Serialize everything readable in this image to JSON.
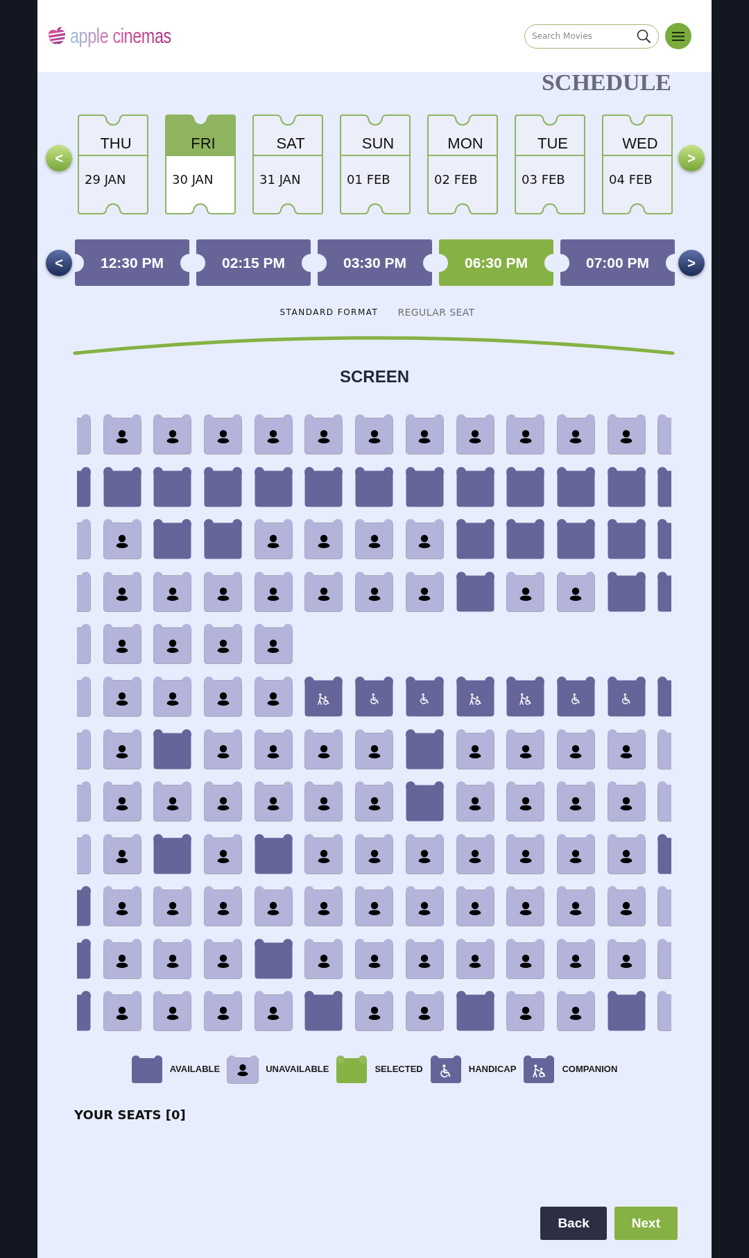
{
  "header": {
    "logo_text": "apple cinemas",
    "search": {
      "placeholder": "Search Movies"
    }
  },
  "schedule": {
    "title": "SCHEDULE",
    "date_nav": {
      "prev": "<",
      "next": ">"
    },
    "dates": [
      {
        "day": "THU",
        "date": "29 JAN",
        "selected": false
      },
      {
        "day": "FRI",
        "date": "30 JAN",
        "selected": true
      },
      {
        "day": "SAT",
        "date": "31 JAN",
        "selected": false
      },
      {
        "day": "SUN",
        "date": "01 FEB",
        "selected": false
      },
      {
        "day": "MON",
        "date": "02 FEB",
        "selected": false
      },
      {
        "day": "TUE",
        "date": "03 FEB",
        "selected": false
      },
      {
        "day": "WED",
        "date": "04 FEB",
        "selected": false
      }
    ],
    "time_nav": {
      "prev": "<",
      "next": ">"
    },
    "times": [
      {
        "label": "12:30 PM",
        "selected": false
      },
      {
        "label": "02:15 PM",
        "selected": false
      },
      {
        "label": "03:30 PM",
        "selected": false
      },
      {
        "label": "06:30 PM",
        "selected": true
      },
      {
        "label": "07:00 PM",
        "selected": false
      }
    ],
    "format": "STANDARD FORMAT",
    "seat_type": "REGULAR SEAT"
  },
  "screen_label": "SCREEN",
  "seat_sections": [
    {
      "rows": [
        {
          "seats": [
            {
              "kind": "unavailable"
            },
            {
              "kind": "unavailable"
            },
            {
              "kind": "unavailable"
            },
            {
              "kind": "unavailable"
            },
            {
              "kind": "unavailable"
            },
            {
              "kind": "unavailable"
            },
            {
              "kind": "unavailable"
            },
            {
              "kind": "unavailable"
            },
            {
              "kind": "unavailable"
            },
            {
              "kind": "unavailable"
            },
            {
              "kind": "unavailable"
            },
            {
              "kind": "unavailable"
            },
            {
              "kind": "unavailable"
            }
          ]
        },
        {
          "seats": [
            {
              "kind": "available"
            },
            {
              "kind": "available"
            },
            {
              "kind": "available"
            },
            {
              "kind": "available"
            },
            {
              "kind": "available"
            },
            {
              "kind": "available"
            },
            {
              "kind": "available"
            },
            {
              "kind": "available"
            },
            {
              "kind": "available"
            },
            {
              "kind": "available"
            },
            {
              "kind": "available"
            },
            {
              "kind": "available"
            },
            {
              "kind": "available"
            }
          ]
        },
        {
          "seats": [
            {
              "kind": "unavailable"
            },
            {
              "kind": "unavailable"
            },
            {
              "kind": "available"
            },
            {
              "kind": "available"
            },
            {
              "kind": "unavailable"
            },
            {
              "kind": "unavailable"
            },
            {
              "kind": "unavailable"
            },
            {
              "kind": "unavailable"
            },
            {
              "kind": "available"
            },
            {
              "kind": "available"
            },
            {
              "kind": "available"
            },
            {
              "kind": "available"
            },
            {
              "kind": "available"
            }
          ]
        },
        {
          "seats": [
            {
              "kind": "unavailable"
            },
            {
              "kind": "unavailable"
            },
            {
              "kind": "unavailable"
            },
            {
              "kind": "unavailable"
            },
            {
              "kind": "unavailable"
            },
            {
              "kind": "unavailable"
            },
            {
              "kind": "unavailable"
            },
            {
              "kind": "unavailable"
            },
            {
              "kind": "available"
            },
            {
              "kind": "unavailable"
            },
            {
              "kind": "unavailable"
            },
            {
              "kind": "available"
            },
            {
              "kind": "available"
            }
          ]
        },
        {
          "seats": [
            {
              "kind": "unavailable"
            },
            {
              "kind": "unavailable"
            },
            {
              "kind": "unavailable"
            },
            {
              "kind": "unavailable"
            },
            {
              "kind": "unavailable"
            }
          ]
        }
      ]
    },
    {
      "rows": [
        {
          "seats": [
            {
              "kind": "unavailable"
            },
            {
              "kind": "unavailable"
            },
            {
              "kind": "unavailable"
            },
            {
              "kind": "unavailable"
            },
            {
              "kind": "unavailable"
            },
            {
              "kind": "companion"
            },
            {
              "kind": "handicap"
            },
            {
              "kind": "handicap"
            },
            {
              "kind": "companion"
            },
            {
              "kind": "companion"
            },
            {
              "kind": "handicap"
            },
            {
              "kind": "handicap"
            },
            {
              "kind": "available"
            }
          ]
        },
        {
          "seats": [
            {
              "kind": "unavailable"
            },
            {
              "kind": "unavailable"
            },
            {
              "kind": "available"
            },
            {
              "kind": "unavailable"
            },
            {
              "kind": "unavailable"
            },
            {
              "kind": "unavailable"
            },
            {
              "kind": "unavailable"
            },
            {
              "kind": "available"
            },
            {
              "kind": "unavailable"
            },
            {
              "kind": "unavailable"
            },
            {
              "kind": "unavailable"
            },
            {
              "kind": "unavailable"
            },
            {
              "kind": "unavailable"
            }
          ]
        },
        {
          "seats": [
            {
              "kind": "unavailable"
            },
            {
              "kind": "unavailable"
            },
            {
              "kind": "unavailable"
            },
            {
              "kind": "unavailable"
            },
            {
              "kind": "unavailable"
            },
            {
              "kind": "unavailable"
            },
            {
              "kind": "unavailable"
            },
            {
              "kind": "available"
            },
            {
              "kind": "unavailable"
            },
            {
              "kind": "unavailable"
            },
            {
              "kind": "unavailable"
            },
            {
              "kind": "unavailable"
            },
            {
              "kind": "unavailable"
            }
          ]
        },
        {
          "seats": [
            {
              "kind": "unavailable"
            },
            {
              "kind": "unavailable"
            },
            {
              "kind": "available"
            },
            {
              "kind": "unavailable"
            },
            {
              "kind": "available"
            },
            {
              "kind": "unavailable"
            },
            {
              "kind": "unavailable"
            },
            {
              "kind": "unavailable"
            },
            {
              "kind": "unavailable"
            },
            {
              "kind": "unavailable"
            },
            {
              "kind": "unavailable"
            },
            {
              "kind": "unavailable"
            },
            {
              "kind": "available"
            }
          ]
        },
        {
          "seats": [
            {
              "kind": "available"
            },
            {
              "kind": "unavailable"
            },
            {
              "kind": "unavailable"
            },
            {
              "kind": "unavailable"
            },
            {
              "kind": "unavailable"
            },
            {
              "kind": "unavailable"
            },
            {
              "kind": "unavailable"
            },
            {
              "kind": "unavailable"
            },
            {
              "kind": "unavailable"
            },
            {
              "kind": "unavailable"
            },
            {
              "kind": "unavailable"
            },
            {
              "kind": "unavailable"
            },
            {
              "kind": "unavailable"
            }
          ]
        },
        {
          "seats": [
            {
              "kind": "available"
            },
            {
              "kind": "unavailable"
            },
            {
              "kind": "unavailable"
            },
            {
              "kind": "unavailable"
            },
            {
              "kind": "available"
            },
            {
              "kind": "unavailable"
            },
            {
              "kind": "unavailable"
            },
            {
              "kind": "unavailable"
            },
            {
              "kind": "unavailable"
            },
            {
              "kind": "unavailable"
            },
            {
              "kind": "unavailable"
            },
            {
              "kind": "unavailable"
            },
            {
              "kind": "unavailable"
            }
          ]
        },
        {
          "seats": [
            {
              "kind": "available"
            },
            {
              "kind": "unavailable"
            },
            {
              "kind": "unavailable"
            },
            {
              "kind": "unavailable"
            },
            {
              "kind": "unavailable"
            },
            {
              "kind": "available"
            },
            {
              "kind": "unavailable"
            },
            {
              "kind": "unavailable"
            },
            {
              "kind": "available"
            },
            {
              "kind": "unavailable"
            },
            {
              "kind": "unavailable"
            },
            {
              "kind": "available"
            },
            {
              "kind": "unavailable"
            }
          ]
        }
      ]
    }
  ],
  "legend": [
    {
      "kind": "available",
      "label": "AVAILABLE"
    },
    {
      "kind": "unavailable",
      "label": "UNAVAILABLE"
    },
    {
      "kind": "selected",
      "label": "SELECTED"
    },
    {
      "kind": "handicap",
      "label": "HANDICAP"
    },
    {
      "kind": "companion",
      "label": "COMPANION"
    }
  ],
  "your_seats": "YOUR SEATS [0]",
  "buttons": [
    {
      "kind": "back",
      "label": "Back"
    },
    {
      "kind": "next",
      "label": "Next"
    }
  ]
}
